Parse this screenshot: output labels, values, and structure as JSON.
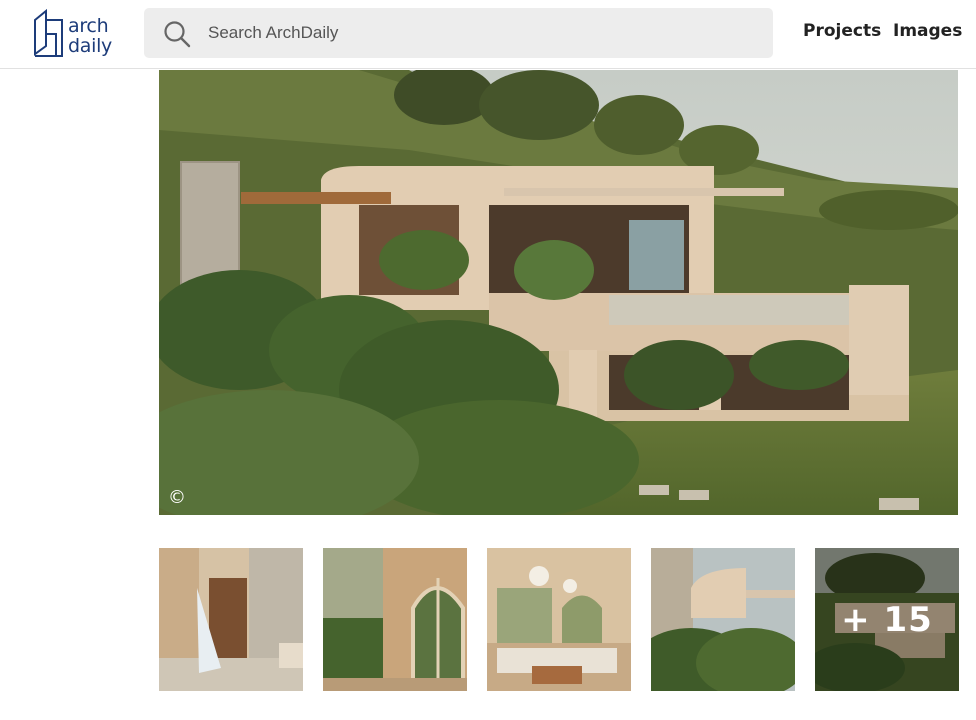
{
  "header": {
    "logo": {
      "line1": "arch",
      "line2": "daily"
    },
    "search": {
      "placeholder": "Search ArchDaily"
    },
    "nav": [
      {
        "label": "Projects"
      },
      {
        "label": "Images"
      }
    ]
  },
  "hero": {
    "copyright_symbol": "©"
  },
  "gallery": {
    "more_label": "+ 15"
  },
  "colors": {
    "brand_blue": "#1d3c7a",
    "search_bg": "#ededed"
  }
}
